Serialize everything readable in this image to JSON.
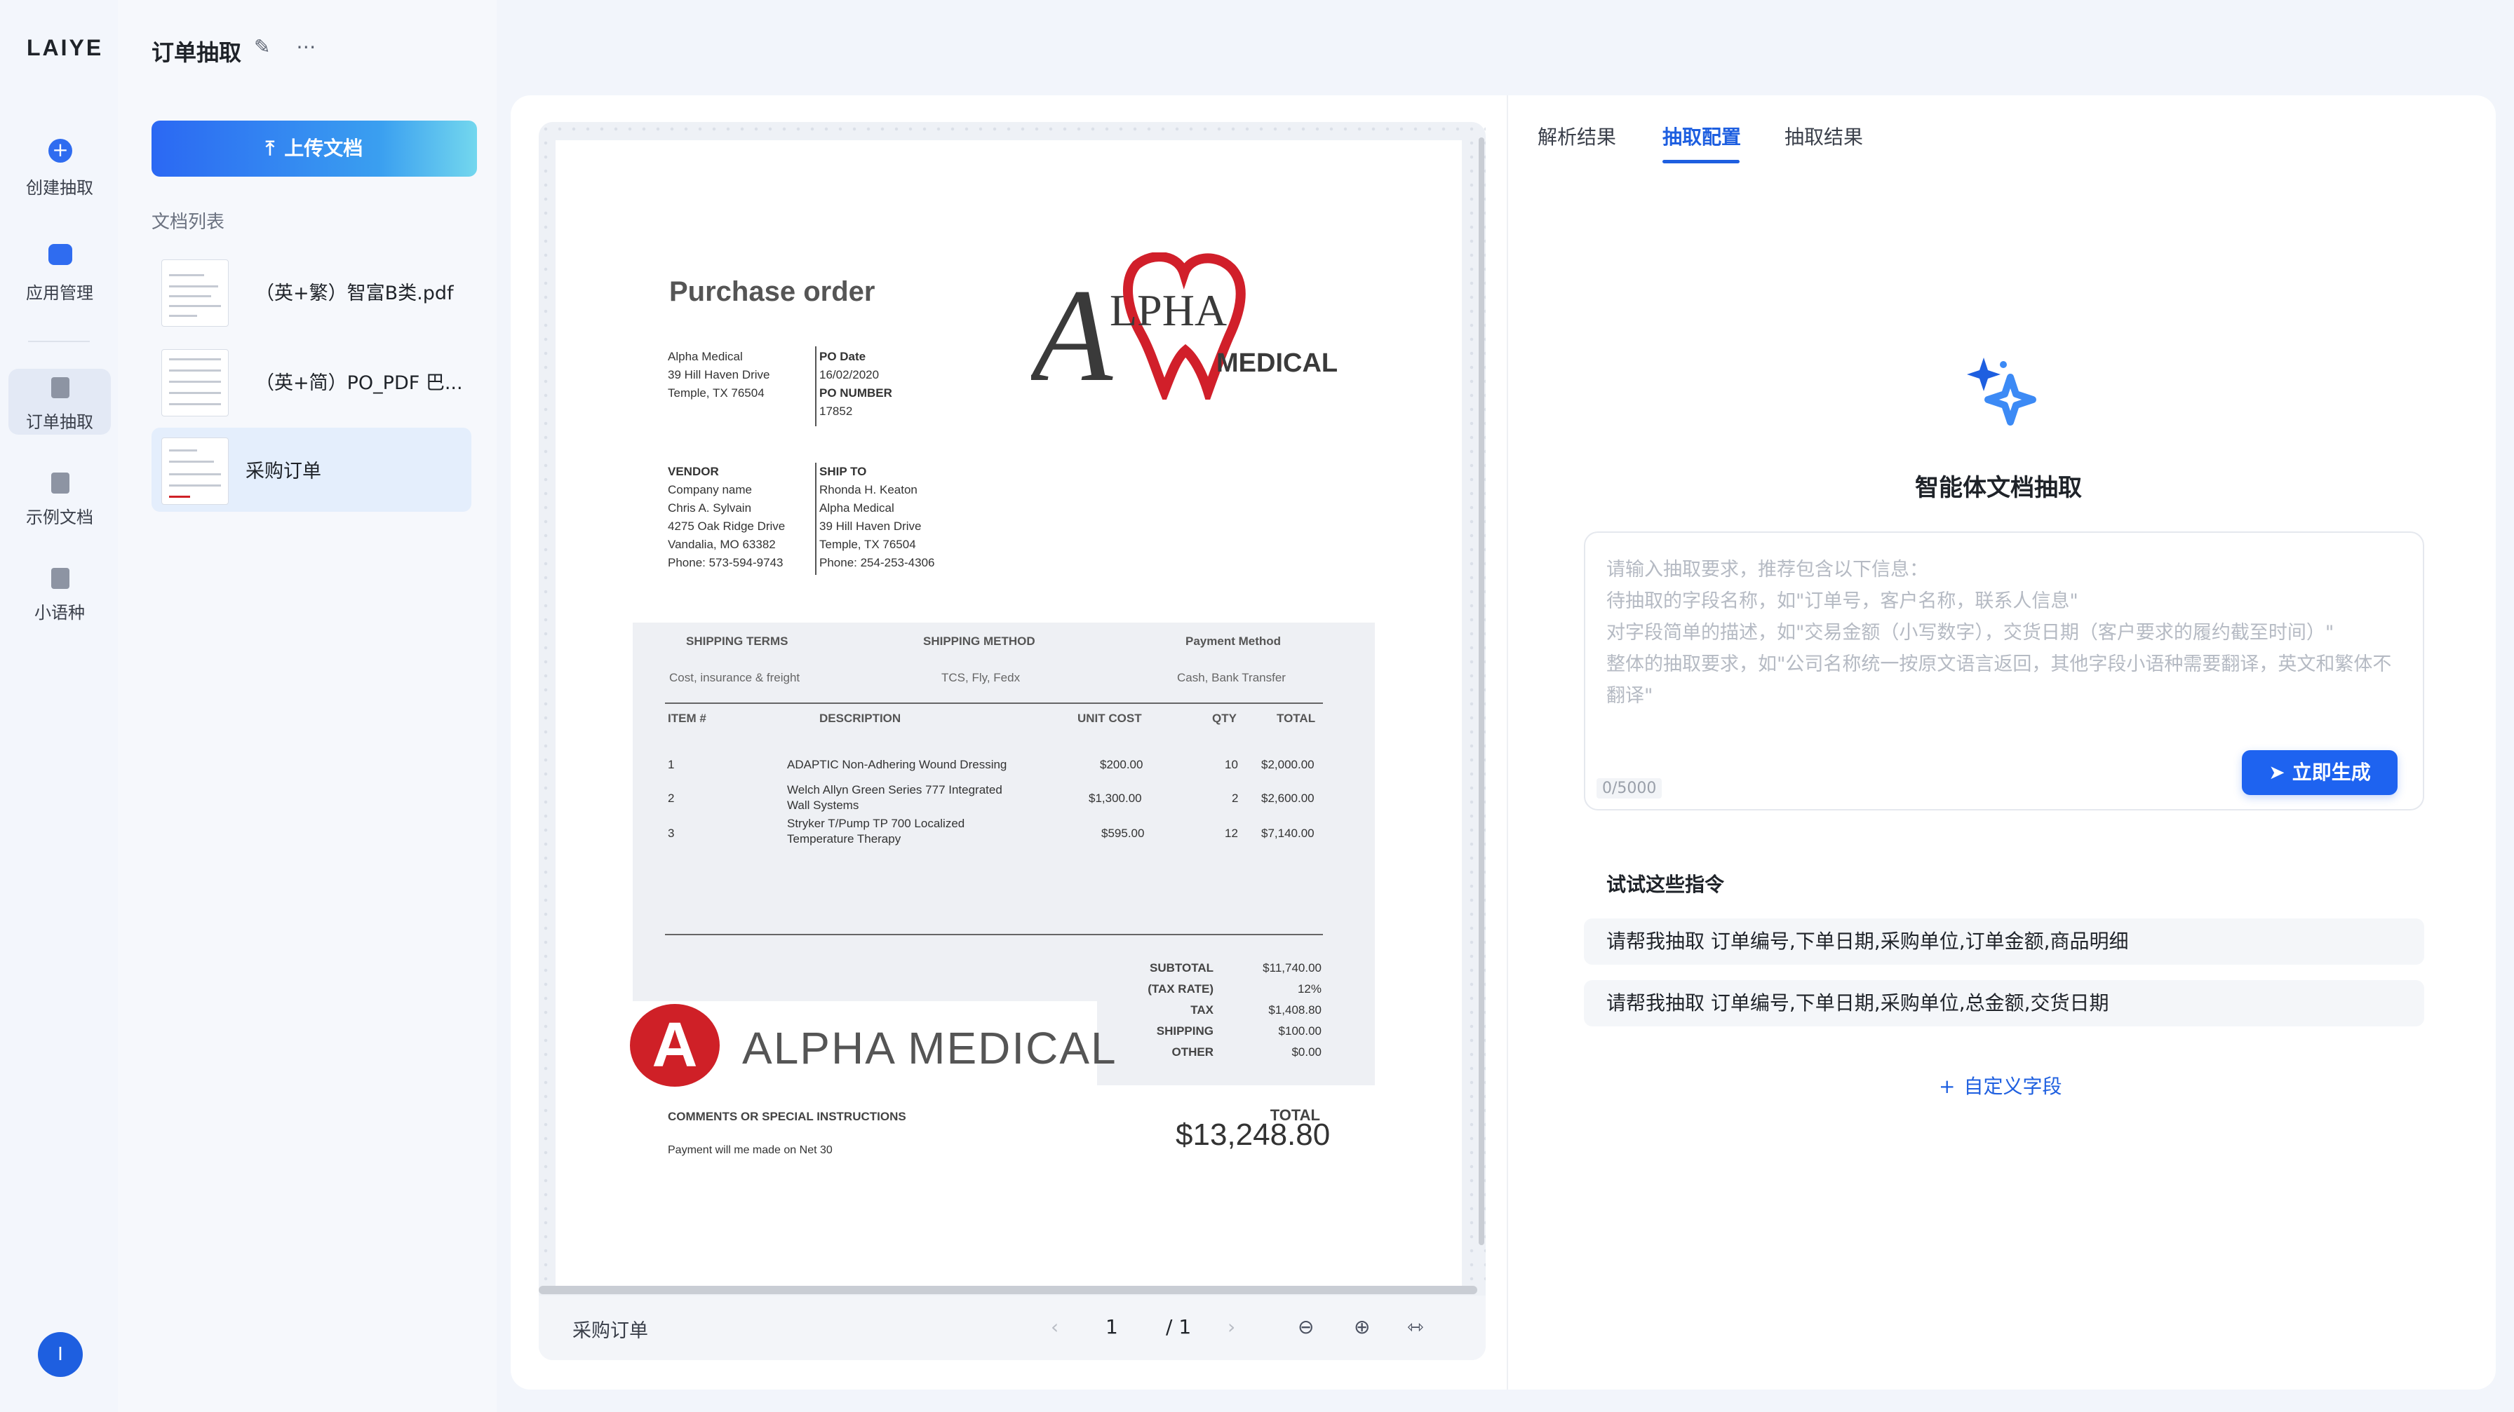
{
  "nav": {
    "logo": "LAIYE",
    "items": [
      {
        "label": "创建抽取",
        "icon": "plus-icon"
      },
      {
        "label": "应用管理",
        "icon": "folder-icon"
      },
      {
        "label": "订单抽取",
        "icon": "document-icon"
      },
      {
        "label": "示例文档",
        "icon": "document-icon"
      },
      {
        "label": "小语种",
        "icon": "document-icon"
      }
    ],
    "avatar": "I"
  },
  "project": {
    "title": "订单抽取",
    "upload_label": "上传文档",
    "doclist_label": "文档列表",
    "docs": [
      {
        "name": "（英+繁）智富B类.pdf"
      },
      {
        "name": "（英+简）PO_PDF 巴..."
      },
      {
        "name": "采购订单"
      }
    ]
  },
  "viewer": {
    "doc_name": "采购订单",
    "page_current": "1",
    "page_total": "/ 1"
  },
  "document": {
    "title": "Purchase order",
    "from_name": "Alpha Medical",
    "from_addr1": "39 Hill Haven Drive",
    "from_addr2": "Temple, TX 76504",
    "po_date_lbl": "PO Date",
    "po_date": "16/02/2020",
    "po_number_lbl": "PO NUMBER",
    "po_number": "17852",
    "logo_top": "LPHA",
    "logo_bottom": "MEDICAL",
    "vendor_lbl": "VENDOR",
    "vendor_lines": [
      "Company name",
      "Chris A. Sylvain",
      "4275 Oak Ridge Drive",
      "Vandalia, MO 63382",
      "Phone: 573-594-9743"
    ],
    "shipto_lbl": "SHIP TO",
    "shipto_lines": [
      "Rhonda H. Keaton",
      "Alpha Medical",
      "39 Hill Haven Drive",
      "Temple, TX 76504",
      "Phone: 254-253-4306"
    ],
    "shipping_terms_lbl": "SHIPPING TERMS",
    "shipping_terms": "Cost, insurance & freight",
    "shipping_method_lbl": "SHIPPING METHOD",
    "shipping_method": "TCS, Fly, Fedx",
    "payment_method_lbl": "Payment Method",
    "payment_method": "Cash, Bank Transfer",
    "columns": [
      "ITEM #",
      "DESCRIPTION",
      "UNIT COST",
      "QTY",
      "TOTAL"
    ],
    "rows": [
      {
        "item": "1",
        "desc1": "ADAPTIC Non-Adhering Wound Dressing",
        "desc2": "",
        "unit": "$200.00",
        "qty": "10",
        "total": "$2,000.00"
      },
      {
        "item": "2",
        "desc1": "Welch Allyn Green Series 777 Integrated",
        "desc2": "Wall Systems",
        "unit": "$1,300.00",
        "qty": "2",
        "total": "$2,600.00"
      },
      {
        "item": "3",
        "desc1": "Stryker T/Pump TP 700 Localized",
        "desc2": "Temperature Therapy",
        "unit": "$595.00",
        "qty": "12",
        "total": "$7,140.00"
      }
    ],
    "summary": [
      {
        "label": "SUBTOTAL",
        "value": "$11,740.00"
      },
      {
        "label": "(TAX RATE)",
        "value": "12%"
      },
      {
        "label": "TAX",
        "value": "$1,408.80"
      },
      {
        "label": "SHIPPING",
        "value": "$100.00"
      },
      {
        "label": "OTHER",
        "value": "$0.00"
      }
    ],
    "logo2_letter": "A",
    "logo2_text": "ALPHA MEDICAL",
    "comments_lbl": "COMMENTS OR SPECIAL INSTRUCTIONS",
    "comments": "Payment will me made on Net 30",
    "total_lbl": "TOTAL",
    "total": "$13,248.80"
  },
  "right": {
    "tabs": [
      "解析结果",
      "抽取配置",
      "抽取结果"
    ],
    "active_tab": "抽取配置",
    "hero_title": "智能体文档抽取",
    "prompt_placeholder": "请输入抽取要求，推荐包含以下信息：\n待抽取的字段名称，如\"订单号，客户名称，联系人信息\"\n对字段简单的描述，如\"交易金额（小写数字），交货日期（客户要求的履约截至时间）\"\n整体的抽取要求，如\"公司名称统一按原文语言返回，其他字段小语种需要翻译，英文和繁体不翻译\"",
    "counter": "0/5000",
    "generate_label": "立即生成",
    "try_title": "试试这些指令",
    "suggestions": [
      "请帮我抽取 订单编号,下单日期,采购单位,订单金额,商品明细",
      "请帮我抽取 订单编号,下单日期,采购单位,总金额,交货日期"
    ],
    "custom_label": "自定义字段"
  },
  "colors": {
    "accent": "#1e5fe0",
    "brand_red": "#cf2027"
  }
}
